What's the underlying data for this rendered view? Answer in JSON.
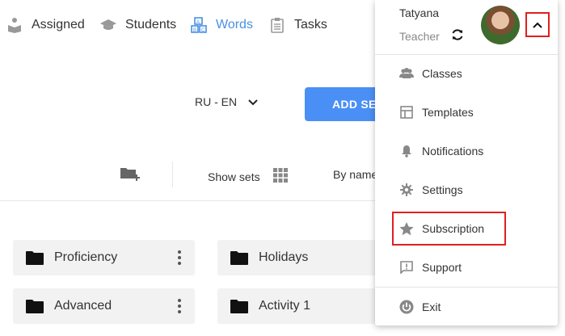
{
  "nav": {
    "items": [
      {
        "label": "Assigned",
        "icon": "reader-icon",
        "active": false
      },
      {
        "label": "Students",
        "icon": "graduation-cap-icon",
        "active": false
      },
      {
        "label": "Words",
        "icon": "abc-blocks-icon",
        "active": true
      },
      {
        "label": "Tasks",
        "icon": "clipboard-icon",
        "active": false
      }
    ],
    "active_color": "#4a90e2"
  },
  "toolbar": {
    "language": "RU - EN",
    "add_set_label": "ADD SET",
    "show_sets_label": "Show sets",
    "sort_label": "By name"
  },
  "folders": [
    {
      "name": "Proficiency"
    },
    {
      "name": "Holidays"
    },
    {
      "name": "Advanced"
    },
    {
      "name": "Activity 1"
    }
  ],
  "user_menu": {
    "name": "Tatyana",
    "role": "Teacher",
    "items": [
      {
        "label": "Classes",
        "icon": "people-icon"
      },
      {
        "label": "Templates",
        "icon": "template-icon"
      },
      {
        "label": "Notifications",
        "icon": "bell-icon"
      },
      {
        "label": "Settings",
        "icon": "gear-icon"
      },
      {
        "label": "Subscription",
        "icon": "star-icon"
      },
      {
        "label": "Support",
        "icon": "feedback-icon"
      }
    ],
    "exit_label": "Exit"
  },
  "colors": {
    "accent": "#4a8ff5",
    "highlight": "#e0201f"
  }
}
